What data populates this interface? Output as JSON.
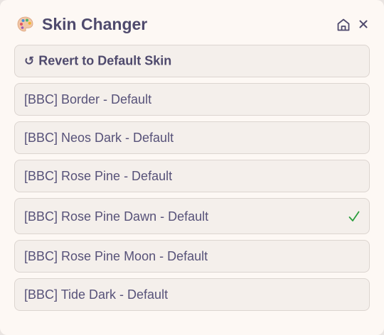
{
  "header": {
    "title": "Skin Changer",
    "app_icon": "palette-icon",
    "home_icon": "home-icon",
    "close_icon": "close-icon"
  },
  "revert": {
    "icon": "↺",
    "label": "Revert to Default Skin"
  },
  "skins": [
    {
      "label": "[BBC] Border - Default",
      "selected": false
    },
    {
      "label": "[BBC] Neos Dark - Default",
      "selected": false
    },
    {
      "label": "[BBC] Rose Pine - Default",
      "selected": false
    },
    {
      "label": "[BBC] Rose Pine Dawn - Default",
      "selected": true
    },
    {
      "label": "[BBC] Rose Pine Moon - Default",
      "selected": false
    },
    {
      "label": "[BBC] Tide Dark - Default",
      "selected": false
    }
  ],
  "colors": {
    "panel_bg": "#fdf8f4",
    "item_bg": "#f4efeb",
    "text": "#575279",
    "check": "#2a9d3c"
  }
}
